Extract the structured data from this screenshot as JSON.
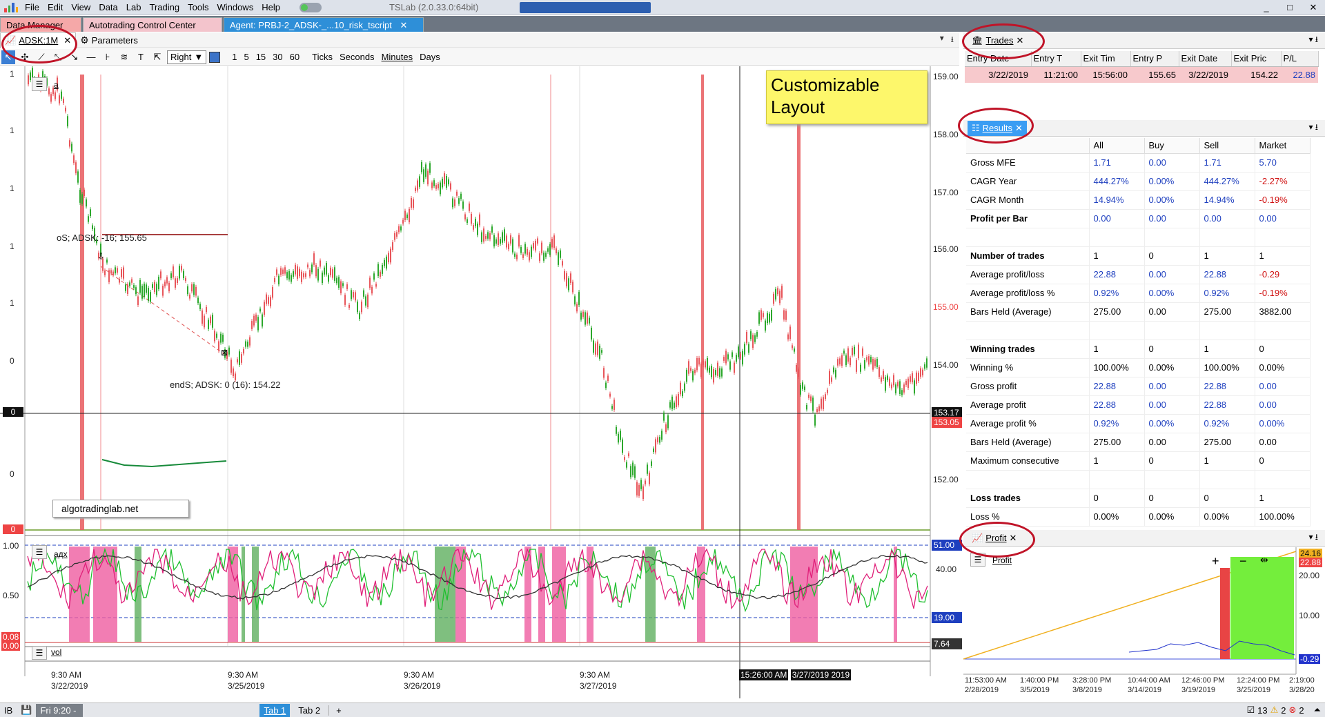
{
  "titlebar": {
    "menus": [
      "File",
      "Edit",
      "View",
      "Data",
      "Lab",
      "Trading",
      "Tools",
      "Windows",
      "Help"
    ],
    "app_title": "TSLab (2.0.33.0:64bit)",
    "controls": [
      "_",
      "□",
      "✕"
    ]
  },
  "doc_tabs": {
    "data_manager": "Data Manager",
    "atc": "Autotrading Control Center",
    "agent": "Agent: PRBJ-2_ADSK-_...10_risk_tscript",
    "agent_close": "✕"
  },
  "chart_panel": {
    "tab_symbol": "ADSK:1M",
    "tab_close": "✕",
    "tab_parameters": "Parameters"
  },
  "toolbar": {
    "align": "Right",
    "timeframes": [
      "1",
      "5",
      "15",
      "30",
      "60"
    ],
    "modes": [
      "Ticks",
      "Seconds",
      "Minutes",
      "Days"
    ]
  },
  "chart": {
    "price_pane_label": "a",
    "adx_pane_label": "адх",
    "vol_pane_label": "vol",
    "entry_label": "oS; ADSK: -16; 155.65",
    "exit_label": "endS; ADSK: 0 (16): 154.22",
    "watermark": "algotradinglab.net",
    "note": "Customizable Layout",
    "y_labels_price": [
      "159.00",
      "158.00",
      "157.00",
      "156.00",
      "155.00",
      "154.00",
      "152.00"
    ],
    "y_label_red": "155.00",
    "price_tag_black": "153.17",
    "price_tag_red": "153.05",
    "left_axis_price": [
      "1",
      "1",
      "1",
      "1",
      "1",
      "0",
      "0",
      "0",
      "0"
    ],
    "y_labels_adx": [
      "40.00",
      "20.00"
    ],
    "adx_tag_51": "51.00",
    "adx_tag_19": "19.00",
    "vol_tag": "7.64",
    "left_axis_adx": [
      "1.00",
      "0.50",
      "0.08",
      "0.00"
    ],
    "x_labels": [
      {
        "time": "9:30 AM",
        "date": "3/22/2019"
      },
      {
        "time": "9:30 AM",
        "date": "3/25/2019"
      },
      {
        "time": "9:30 AM",
        "date": "3/26/2019"
      },
      {
        "time": "9:30 AM",
        "date": "3/27/2019"
      },
      {
        "time": "15:26:00 AM",
        "date": "3/27/2019 2019"
      }
    ],
    "crosshair_time": "15:26:00",
    "crosshair_date": "3/27/2019"
  },
  "trades_panel": {
    "tab": "Trades",
    "close": "✕",
    "columns": [
      "Entry Date",
      "Entry T",
      "Exit Tim",
      "Entry P",
      "Exit Date",
      "Exit Pric",
      "P/L"
    ],
    "rows": [
      [
        "3/22/2019",
        "11:21:00",
        "15:56:00",
        "155.65",
        "3/22/2019",
        "154.22",
        "22.88"
      ]
    ]
  },
  "results_panel": {
    "tab": "Results",
    "close": "✕",
    "columns": [
      "",
      "All",
      "Buy",
      "Sell",
      "Market"
    ],
    "rows": [
      {
        "label": "Gross MFE",
        "bold": false,
        "values": [
          "1.71",
          "0.00",
          "1.71",
          "5.70"
        ],
        "colors": [
          "blue",
          "blue",
          "blue",
          "blue"
        ]
      },
      {
        "label": "CAGR Year",
        "bold": false,
        "values": [
          "444.27%",
          "0.00%",
          "444.27%",
          "-2.27%"
        ],
        "colors": [
          "blue",
          "blue",
          "blue",
          "red"
        ]
      },
      {
        "label": "CAGR Month",
        "bold": false,
        "values": [
          "14.94%",
          "0.00%",
          "14.94%",
          "-0.19%"
        ],
        "colors": [
          "blue",
          "blue",
          "blue",
          "red"
        ]
      },
      {
        "label": "Profit per Bar",
        "bold": true,
        "values": [
          "0.00",
          "0.00",
          "0.00",
          "0.00"
        ],
        "colors": [
          "blue",
          "blue",
          "blue",
          "blue"
        ]
      },
      {
        "label": "",
        "bold": false,
        "values": [
          "",
          "",
          "",
          ""
        ],
        "colors": [
          "blk",
          "blk",
          "blk",
          "blk"
        ]
      },
      {
        "label": "Number of trades",
        "bold": true,
        "values": [
          "1",
          "0",
          "1",
          "1"
        ],
        "colors": [
          "blk",
          "blk",
          "blk",
          "blk"
        ]
      },
      {
        "label": "Average profit/loss",
        "bold": false,
        "values": [
          "22.88",
          "0.00",
          "22.88",
          "-0.29"
        ],
        "colors": [
          "blue",
          "blue",
          "blue",
          "red"
        ]
      },
      {
        "label": "Average profit/loss %",
        "bold": false,
        "values": [
          "0.92%",
          "0.00%",
          "0.92%",
          "-0.19%"
        ],
        "colors": [
          "blue",
          "blue",
          "blue",
          "red"
        ]
      },
      {
        "label": "Bars Held (Average)",
        "bold": false,
        "values": [
          "275.00",
          "0.00",
          "275.00",
          "3882.00"
        ],
        "colors": [
          "blk",
          "blk",
          "blk",
          "blk"
        ]
      },
      {
        "label": "",
        "bold": false,
        "values": [
          "",
          "",
          "",
          ""
        ],
        "colors": [
          "blk",
          "blk",
          "blk",
          "blk"
        ]
      },
      {
        "label": "Winning trades",
        "bold": true,
        "values": [
          "1",
          "0",
          "1",
          "0"
        ],
        "colors": [
          "blk",
          "blk",
          "blk",
          "blk"
        ]
      },
      {
        "label": "Winning %",
        "bold": false,
        "values": [
          "100.00%",
          "0.00%",
          "100.00%",
          "0.00%"
        ],
        "colors": [
          "blk",
          "blk",
          "blk",
          "blk"
        ]
      },
      {
        "label": "Gross profit",
        "bold": false,
        "values": [
          "22.88",
          "0.00",
          "22.88",
          "0.00"
        ],
        "colors": [
          "blue",
          "blue",
          "blue",
          "blue"
        ]
      },
      {
        "label": "Average profit",
        "bold": false,
        "values": [
          "22.88",
          "0.00",
          "22.88",
          "0.00"
        ],
        "colors": [
          "blue",
          "blue",
          "blue",
          "blue"
        ]
      },
      {
        "label": "Average profit %",
        "bold": false,
        "values": [
          "0.92%",
          "0.00%",
          "0.92%",
          "0.00%"
        ],
        "colors": [
          "blue",
          "blue",
          "blue",
          "blue"
        ]
      },
      {
        "label": "Bars Held (Average)",
        "bold": false,
        "values": [
          "275.00",
          "0.00",
          "275.00",
          "0.00"
        ],
        "colors": [
          "blk",
          "blk",
          "blk",
          "blk"
        ]
      },
      {
        "label": "Maximum consecutive",
        "bold": false,
        "values": [
          "1",
          "0",
          "1",
          "0"
        ],
        "colors": [
          "blk",
          "blk",
          "blk",
          "blk"
        ]
      },
      {
        "label": "",
        "bold": false,
        "values": [
          "",
          "",
          "",
          ""
        ],
        "colors": [
          "blk",
          "blk",
          "blk",
          "blk"
        ]
      },
      {
        "label": "Loss trades",
        "bold": true,
        "values": [
          "0",
          "0",
          "0",
          "1"
        ],
        "colors": [
          "blk",
          "blk",
          "blk",
          "blk"
        ]
      },
      {
        "label": "Loss %",
        "bold": false,
        "values": [
          "0.00%",
          "0.00%",
          "0.00%",
          "100.00%"
        ],
        "colors": [
          "blk",
          "blk",
          "blk",
          "blk"
        ]
      }
    ]
  },
  "profit_panel": {
    "tab": "Profit",
    "close": "✕",
    "pane_label": "Profit",
    "y_labels": [
      "20.00",
      "10.00"
    ],
    "tag_top": "24.16",
    "tag_red": "22.88",
    "tag_bottom": "-0.29",
    "x_labels": [
      {
        "time": "11:53:00 AM",
        "date": "2/28/2019"
      },
      {
        "time": "1:40:00 PM",
        "date": "3/5/2019"
      },
      {
        "time": "3:28:00 PM",
        "date": "3/8/2019"
      },
      {
        "time": "10:44:00 AM",
        "date": "3/14/2019"
      },
      {
        "time": "12:46:00 PM",
        "date": "3/19/2019"
      },
      {
        "time": "12:24:00 PM",
        "date": "3/25/2019"
      },
      {
        "time": "2:19:00",
        "date": "3/28/20"
      }
    ]
  },
  "statusbar": {
    "ib": "IB",
    "clock": "Fri 9:20 -",
    "tab1": "Tab 1",
    "tab2": "Tab 2",
    "add": "+",
    "count_ok": "13",
    "count_warn": "2",
    "count_err": "2"
  },
  "colors": {
    "bull": "#2ca82c",
    "bear": "#e8555a",
    "highlight_ellipse": "#c01428",
    "accent_blue": "#2e8fd8"
  }
}
